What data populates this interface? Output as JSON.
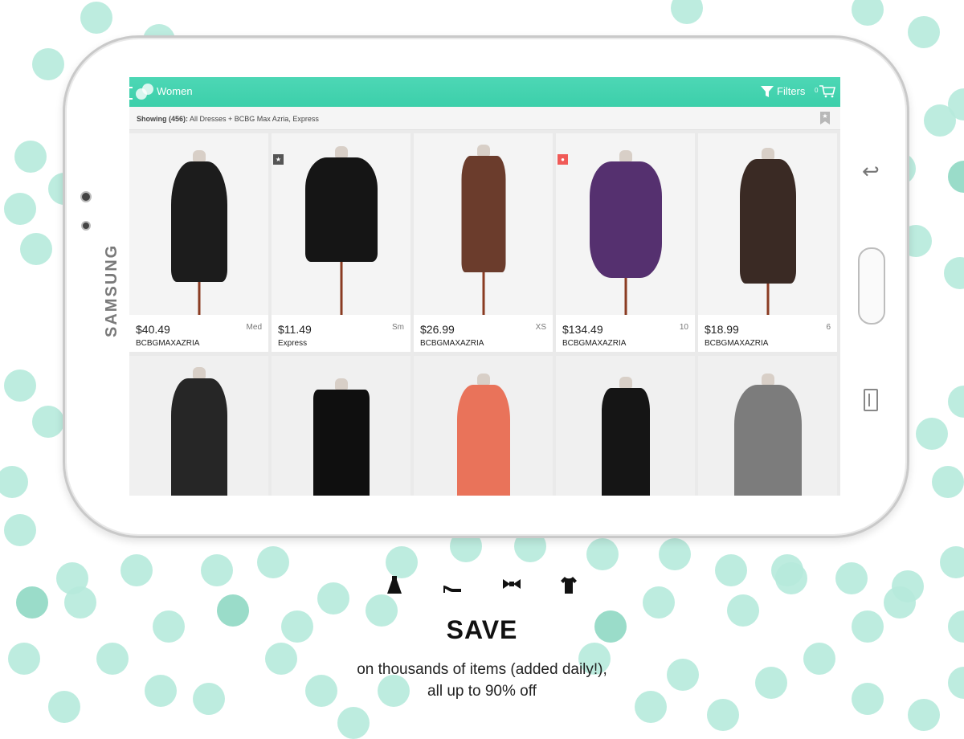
{
  "app": {
    "title": "Women",
    "filters_label": "Filters",
    "cart_count": "0"
  },
  "device": {
    "brand": "SAMSUNG"
  },
  "results": {
    "showing_label": "Showing (456):",
    "showing_filters": "All Dresses + BCBG Max Azria, Express"
  },
  "products": [
    {
      "price": "$40.49",
      "size": "Med",
      "brand": "BCBGMAXAZRIA",
      "color": "#1c1c1c",
      "badge": ""
    },
    {
      "price": "$11.49",
      "size": "Sm",
      "brand": "Express",
      "color": "#151515",
      "badge": "star"
    },
    {
      "price": "$26.99",
      "size": "XS",
      "brand": "BCBGMAXAZRIA",
      "color": "#6b3c2c",
      "badge": ""
    },
    {
      "price": "$134.49",
      "size": "10",
      "brand": "BCBGMAXAZRIA",
      "color": "#55306f",
      "badge": "tag"
    },
    {
      "price": "$18.99",
      "size": "6",
      "brand": "BCBGMAXAZRIA",
      "color": "#3a2a24",
      "badge": ""
    }
  ],
  "products_row2": [
    {
      "color": "#262626"
    },
    {
      "color": "#0f0f0f"
    },
    {
      "color": "#e9735a"
    },
    {
      "color": "#151515"
    },
    {
      "color": "#7c7c7c"
    }
  ],
  "footer": {
    "icons": [
      "dress-icon",
      "heel-icon",
      "bow-icon",
      "tshirt-icon"
    ],
    "headline": "SAVE",
    "line1": "on thousands of items (added daily!),",
    "line2": "all up to 90% off"
  },
  "colors": {
    "accent": "#3ccfaa",
    "dots": "#b6eadb"
  }
}
